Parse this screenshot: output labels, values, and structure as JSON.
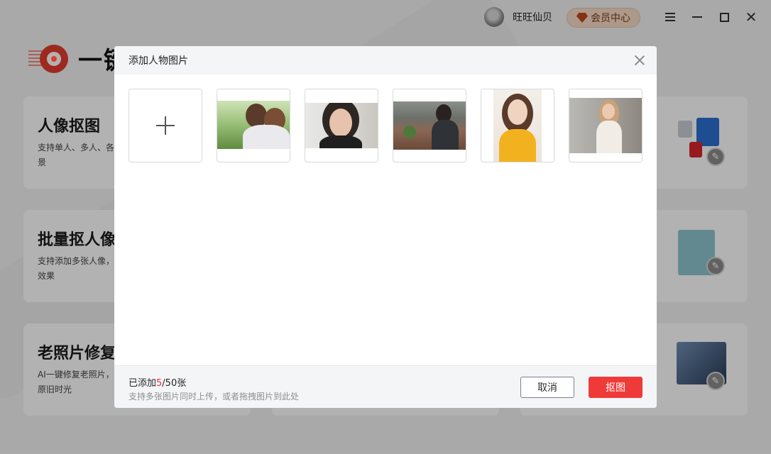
{
  "app": {
    "brand_name": "一键抠图",
    "user": {
      "name": "旺旺仙贝"
    },
    "vip_label": "会员中心",
    "window_controls": [
      "menu-icon",
      "minimize-icon",
      "maximize-icon",
      "close-icon"
    ],
    "cards": [
      {
        "title": "人像抠图",
        "desc": "支持单人、多人、各场景"
      },
      {
        "title": "批量抠人像",
        "desc": "支持添加多张人像，意效果"
      },
      {
        "title": "老照片修复",
        "desc": "AI一键修复老照片，还原旧时光"
      }
    ]
  },
  "dialog": {
    "title": "添加人物图片",
    "add_slot_icon": "plus-icon",
    "images": [
      {
        "alt": "smiling couple"
      },
      {
        "alt": "woman portrait"
      },
      {
        "alt": "woman at table"
      },
      {
        "alt": "woman in yellow"
      },
      {
        "alt": "woman on stairs"
      }
    ],
    "footer": {
      "count_prefix": "已添加",
      "count_added": "5",
      "count_suffix": "/50张",
      "hint": "支持多张图片同时上传，或者拖拽图片到此处",
      "cancel_label": "取消",
      "confirm_label": "抠图"
    }
  },
  "colors": {
    "accent": "#ef3a3a",
    "overlay": "rgba(0,0,0,0.3)",
    "vip_bg": "#f6dcc7"
  }
}
